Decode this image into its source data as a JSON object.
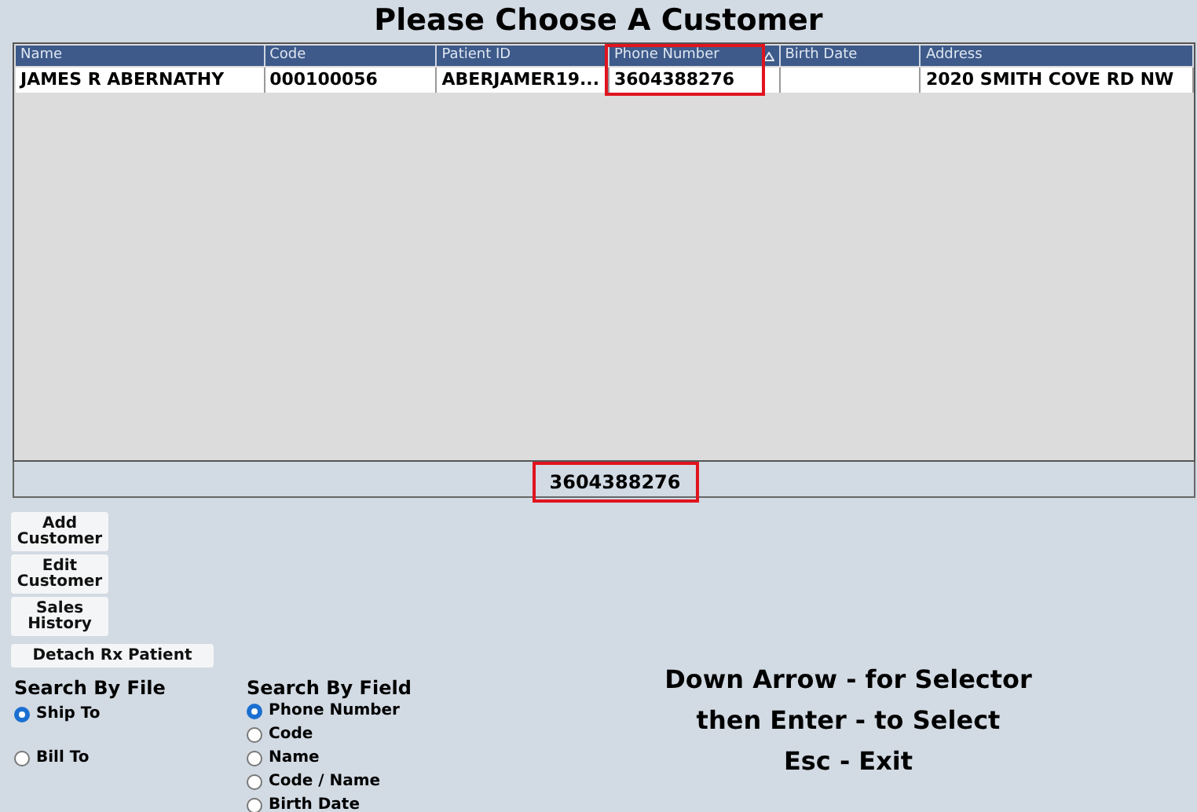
{
  "title": "Please Choose A Customer",
  "table": {
    "columns": [
      {
        "label": "Name",
        "sorted": false,
        "highlighted": false
      },
      {
        "label": "Code",
        "sorted": false,
        "highlighted": false
      },
      {
        "label": "Patient ID",
        "sorted": false,
        "highlighted": false
      },
      {
        "label": "Phone Number",
        "sorted": true,
        "highlighted": true
      },
      {
        "label": "Birth Date",
        "sorted": false,
        "highlighted": false
      },
      {
        "label": "Address",
        "sorted": false,
        "highlighted": false
      }
    ],
    "rows": [
      {
        "cells": [
          "JAMES R ABERNATHY",
          "000100056",
          "ABERJAMER19...",
          "3604388276",
          "",
          "2020 SMITH COVE RD NW"
        ],
        "selected": true
      }
    ]
  },
  "search_value": {
    "text": "3604388276",
    "highlighted": true
  },
  "buttons": [
    "Add Customer",
    "Edit Customer",
    "Sales History"
  ],
  "detach_button": "Detach Rx Patient",
  "search_by_file": {
    "title": "Search By File",
    "options": [
      {
        "label": "Ship To",
        "selected": true
      },
      {
        "label": "Bill To",
        "selected": false
      }
    ]
  },
  "search_by_field": {
    "title": "Search By Field",
    "options": [
      {
        "label": "Phone Number",
        "selected": true
      },
      {
        "label": "Code",
        "selected": false
      },
      {
        "label": "Name",
        "selected": false
      },
      {
        "label": "Code / Name",
        "selected": false
      },
      {
        "label": "Birth Date",
        "selected": false
      }
    ]
  },
  "instructions": [
    "Down Arrow - for Selector",
    "then Enter - to Select",
    "Esc - Exit"
  ]
}
